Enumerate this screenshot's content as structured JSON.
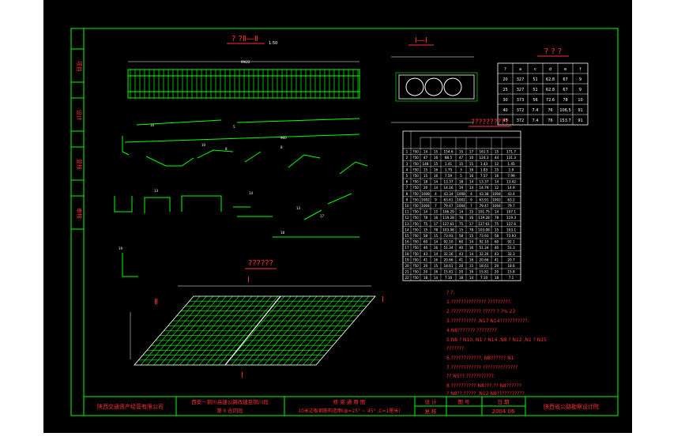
{
  "drawing": {
    "section_title_main": "? ?Ⅱ—Ⅱ",
    "section_title_cross": "Ⅰ—Ⅰ",
    "table_small_title": "? ? ?",
    "table_big_title": "??????????",
    "plan_title": "??????",
    "scale": "1:50",
    "plan_dim": "Ⅱ",
    "plan_mark_I": "Ⅰ",
    "plan_mark_II": "Ⅱ"
  },
  "small_table": {
    "headers": [
      "?",
      "a",
      "c",
      "d",
      "e",
      "f"
    ],
    "rows": [
      [
        "20",
        "327",
        "51",
        "62.8",
        "67",
        "9"
      ],
      [
        "25",
        "327",
        "51",
        "62.8",
        "67",
        "9"
      ],
      [
        "30",
        "373",
        "56",
        "72.6",
        "78",
        "10"
      ],
      [
        "40",
        "372",
        "7.4",
        "76",
        "106.5",
        "91"
      ],
      [
        "45",
        "372",
        "7.4",
        "76",
        "153.7",
        "91"
      ]
    ]
  },
  "big_table": {
    "rows": [
      [
        "1",
        "?50",
        "14",
        "15",
        "154.6",
        "15",
        "17",
        "161.5",
        "15",
        "171.7"
      ],
      [
        "2",
        "?50",
        "47",
        "16",
        "88.5",
        "47",
        "10",
        "124.3",
        "44",
        "131.3"
      ],
      [
        "3",
        "?50",
        "148",
        "15",
        "1.41",
        "15",
        "15",
        "1.43",
        "12",
        "1.45"
      ],
      [
        "4",
        "?50",
        "15",
        "16",
        "1.75",
        "3",
        "16",
        "1.83",
        "15",
        "1.9"
      ],
      [
        "5",
        "?50",
        "15",
        "16",
        "7.59",
        "5",
        "16",
        "7.57",
        "16",
        "7.99"
      ],
      [
        "6",
        "?50",
        "18",
        "14",
        "13.37",
        "18",
        "14",
        "13.37",
        "14",
        "13.42"
      ],
      [
        "7",
        "?50",
        "20",
        "14",
        "14.16",
        "19",
        "14",
        "14.79",
        "12",
        "14.9"
      ],
      [
        "8",
        "?50",
        "1008",
        "4",
        "43.34",
        "1008",
        "4",
        "43.38",
        "1004",
        "43.4"
      ],
      [
        "9",
        "?50",
        "1002",
        "9",
        "63.61",
        "1002",
        "9",
        "63.91",
        "1002",
        "63.2"
      ],
      [
        "10",
        "?50",
        "1004",
        "7",
        "79.47",
        "1004",
        "7",
        "79.47",
        "1004",
        "79.7"
      ],
      [
        "11",
        "?50",
        "14",
        "15",
        "106.29",
        "14",
        "15",
        "101.75",
        "14",
        "107.1"
      ],
      [
        "12",
        "?50",
        "78",
        "16",
        "119.28",
        "78",
        "16",
        "119.28",
        "78",
        "119.3"
      ],
      [
        "13",
        "?50",
        "75",
        "17",
        "127.61",
        "75",
        "17",
        "127.61",
        "75",
        "127.6"
      ],
      [
        "14",
        "?50",
        "15",
        "78",
        "103.08",
        "15",
        "78",
        "103.08",
        "15",
        "103.1"
      ],
      [
        "15",
        "?50",
        "58",
        "15",
        "73.93",
        "58",
        "15",
        "73.93",
        "58",
        "73.93"
      ],
      [
        "16",
        "?50",
        "60",
        "14",
        "92.10",
        "60",
        "14",
        "92.10",
        "60",
        "92.1"
      ],
      [
        "17",
        "?50",
        "40",
        "16",
        "51.34",
        "40",
        "16",
        "51.34",
        "40",
        "51.3"
      ],
      [
        "18",
        "?50",
        "43",
        "14",
        "32.26",
        "43",
        "14",
        "32.26",
        "43",
        "32.3"
      ],
      [
        "19",
        "?50",
        "41",
        "16",
        "20.66",
        "41",
        "16",
        "20.66",
        "41",
        "20.7"
      ],
      [
        "20",
        "?50",
        "20",
        "15",
        "18.61",
        "20",
        "15",
        "18.61",
        "20",
        "18.6"
      ],
      [
        "21",
        "?50",
        "20",
        "16",
        "15.81",
        "20",
        "16",
        "15.81",
        "20",
        "15.8"
      ],
      [
        "22",
        "?50",
        "18",
        "14",
        "7.10",
        "18",
        "14",
        "7.10",
        "18",
        "7.1"
      ]
    ]
  },
  "notes": {
    "heading": "? ?:",
    "lines": [
      "1.?????????????? ?????????.",
      "2.???????????? ????? ? ?% 23",
      "3.?????????? ,N17 N14???????????.",
      "4.N8???????   ????????",
      "5.N8 ? N10, N1 ? N14 ,N8 ? N12 ,N1 ? N15",
      "   ???????.",
      "6.????????????,   N8??????    N1",
      "7.???????????? ??????????????",
      "   ?? N5??.???????????.",
      "8.??????????   N8???,??  N8??????",
      "   ? N8??,????? ,N12  N8???????????"
    ]
  },
  "title_block": {
    "company": "陕西交通资产经营有限公司",
    "project_line1": "西安－铜川高速公路改建至铜川段",
    "project_line2": "第 Ⅱ 合同段",
    "drawing_name1": "桥 梁 通 用 图",
    "drawing_name2": "10米边板钢筋构造图(ф=25° ~ 45° ,C=1厘米)",
    "label_design": "设 计",
    "label_check": "复 核",
    "label_review": "审 核",
    "label_figno": "图 号",
    "label_date": "日 期",
    "date_value": "2004.06",
    "institute": "陕西省公路勘察设计院"
  },
  "sidebar": {
    "labels": [
      "项目",
      "设计",
      "复核",
      "审核"
    ]
  }
}
